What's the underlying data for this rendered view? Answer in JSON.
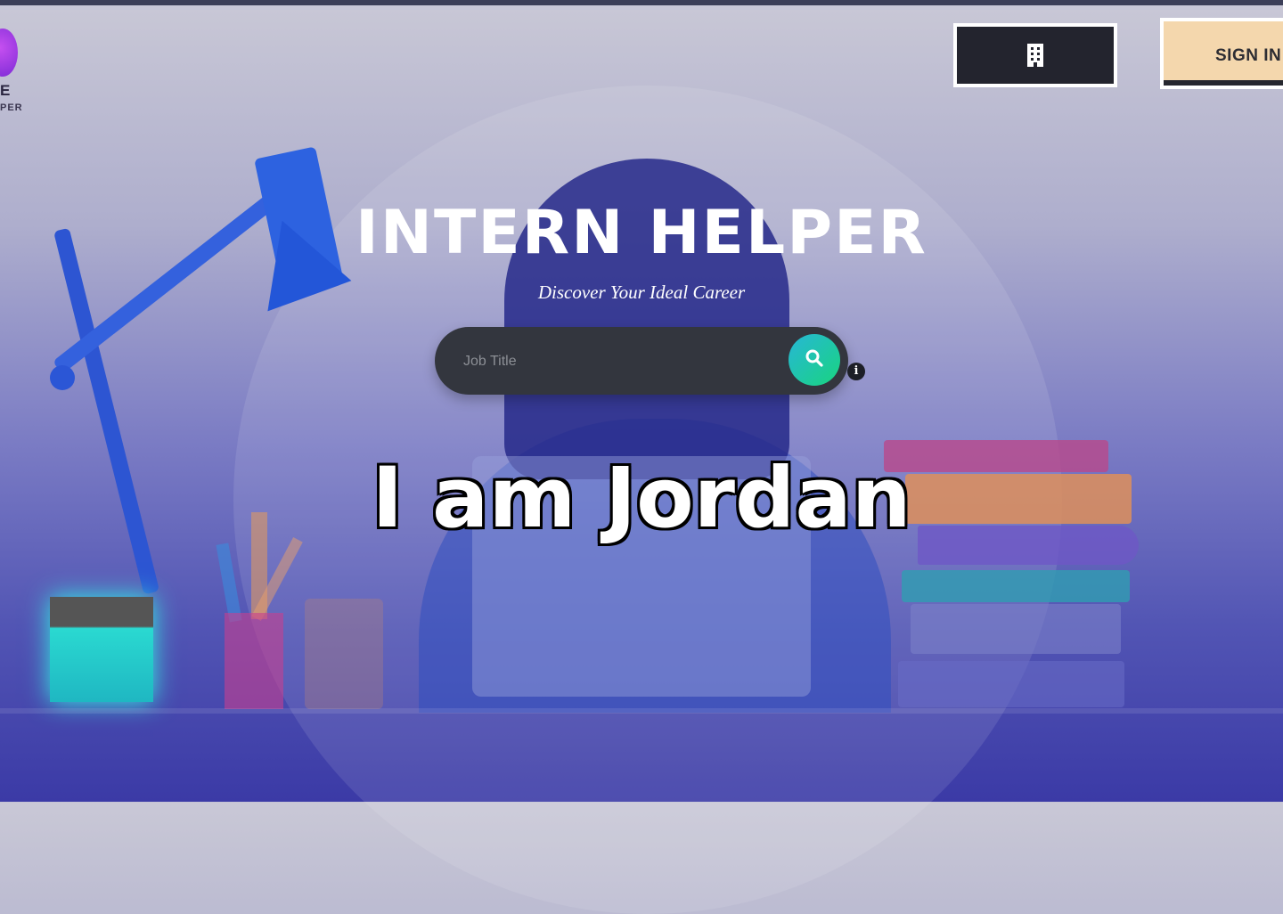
{
  "brand": {
    "logo_text_line1": "E",
    "logo_text_line2": "PER"
  },
  "header": {
    "company_button_icon": "building-icon",
    "signin_label": "SIGN IN"
  },
  "hero": {
    "title": "INTERN HELPER",
    "subtitle": "Discover Your Ideal Career"
  },
  "search": {
    "placeholder": "Job Title",
    "button_icon": "search-icon",
    "info_icon": "info-icon"
  },
  "caption": {
    "text": "I am Jordan"
  },
  "colors": {
    "accent_teal": "#19d47f",
    "signin_bg": "#f4d7ad",
    "dark_button": "#23242e"
  }
}
